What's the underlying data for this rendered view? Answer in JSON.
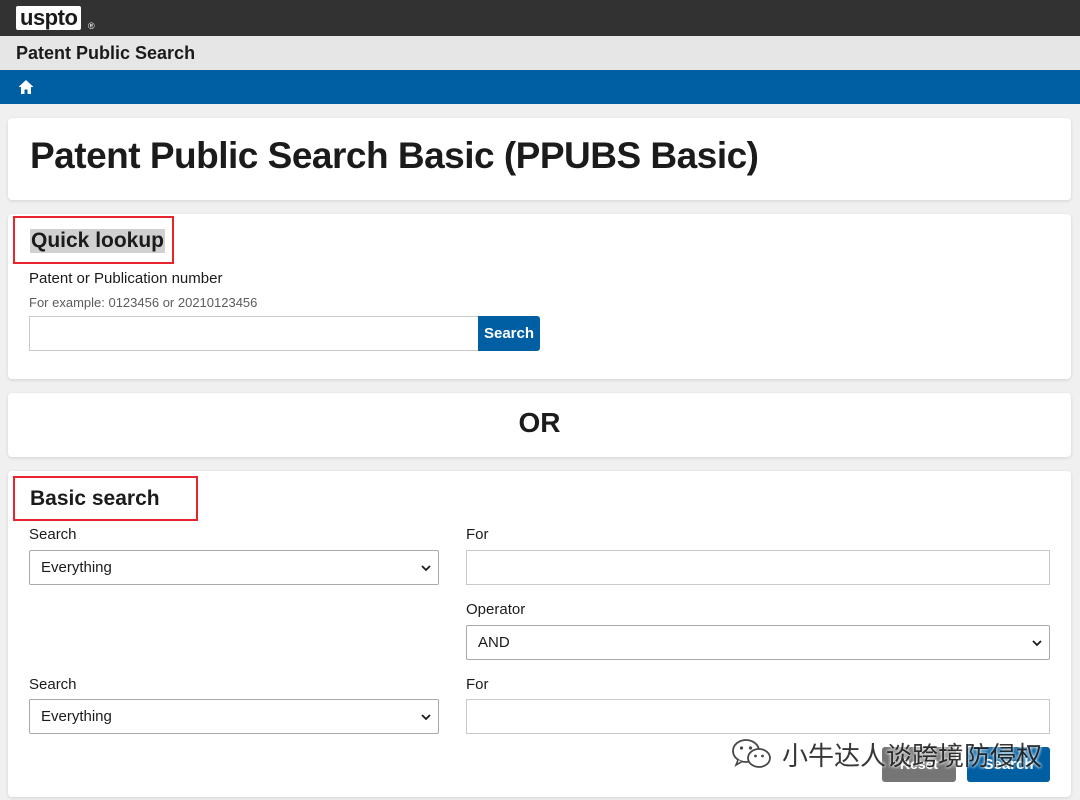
{
  "header": {
    "logo": "uspto",
    "logo_reg": "®",
    "site_title": "Patent Public Search"
  },
  "nav": {
    "home_icon": "home-icon"
  },
  "page": {
    "title": "Patent Public Search Basic (PPUBS Basic)"
  },
  "quick_lookup": {
    "heading": "Quick lookup",
    "field_label": "Patent or Publication number",
    "hint": "For example: 0123456 or 20210123456",
    "input_value": "",
    "search_button": "Search"
  },
  "divider": {
    "or_label": "OR"
  },
  "basic_search": {
    "heading": "Basic search",
    "row1": {
      "search_label": "Search",
      "search_value": "Everything",
      "for_label": "For",
      "for_value": ""
    },
    "operator": {
      "label": "Operator",
      "value": "AND"
    },
    "row2": {
      "search_label": "Search",
      "search_value": "Everything",
      "for_label": "For",
      "for_value": ""
    },
    "reset_button": "Reset",
    "search_button": "Search"
  },
  "watermark": {
    "text": "小牛达人谈跨境防侵权",
    "icon": "wechat-icon"
  },
  "colors": {
    "brand_blue": "#005ea2",
    "topbar": "#323232",
    "highlight_red": "#e8242c"
  }
}
